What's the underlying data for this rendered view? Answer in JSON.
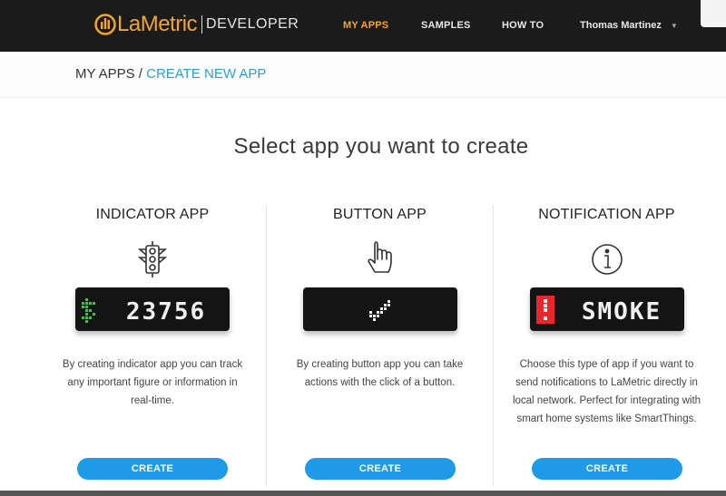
{
  "header": {
    "logo_text": "LaMetric",
    "logo_sub": "DEVELOPER",
    "nav": [
      {
        "label": "MY APPS",
        "active": true
      },
      {
        "label": "SAMPLES",
        "active": false
      },
      {
        "label": "HOW TO",
        "active": false
      }
    ],
    "user": {
      "name": "Thomas Martinez",
      "caret_icon": "triangle-down-icon"
    }
  },
  "breadcrumb": {
    "root": "MY APPS",
    "separator": " / ",
    "current": "CREATE NEW APP"
  },
  "page_heading": "Select app you want to create",
  "apps": [
    {
      "title": "INDICATOR APP",
      "icon": "traffic-light-icon",
      "display": {
        "icon": "dollar-sign",
        "icon_color": "#2ecc40",
        "text": "23756"
      },
      "description": "By creating indicator app you can track any important figure or information in real-time.",
      "button": "CREATE"
    },
    {
      "title": "BUTTON APP",
      "icon": "pointing-hand-icon",
      "display": {
        "icon": "checkmark",
        "icon_color": "#ffffff",
        "text": ""
      },
      "description": "By creating button app you can take actions with the click of a button.",
      "button": "CREATE"
    },
    {
      "title": "NOTIFICATION APP",
      "icon": "info-circle-icon",
      "display": {
        "icon": "exclamation",
        "icon_color": "#e8262b",
        "text": "SMOKE"
      },
      "description": "Choose this type of app if you want to send notifications to LaMetric directly in local network. Perfect for integrating with smart home systems like SmartThings.",
      "button": "CREATE"
    }
  ],
  "colors": {
    "accent": "#f5a623",
    "link": "#2a9fd8",
    "button": "#1e9ae8",
    "header_bg": "#1b1b1b"
  }
}
